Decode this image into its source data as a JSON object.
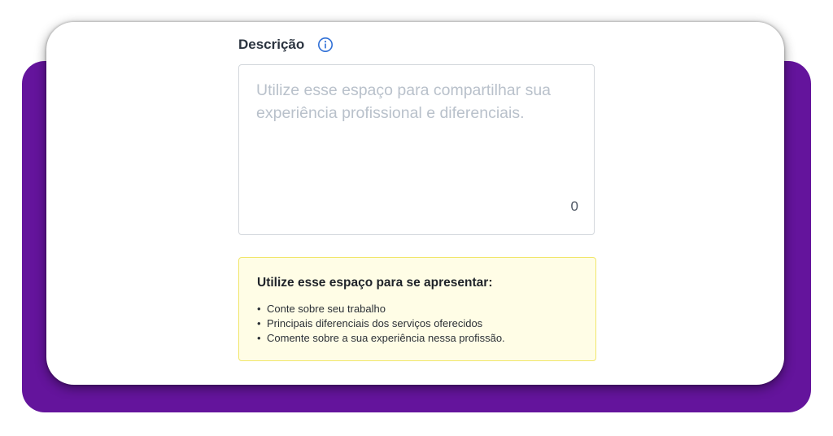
{
  "colors": {
    "backdrop": "#64149c",
    "accent": "#2f6fd6",
    "tip_background": "#fffde6",
    "tip_border": "#f1e66b"
  },
  "description": {
    "label": "Descrição",
    "info_icon": "info-circle-icon",
    "value": "",
    "placeholder": "Utilize esse espaço para compartilhar sua experiência profissional e diferenciais.",
    "char_count": "0"
  },
  "tip": {
    "title": "Utilize esse espaço para se apresentar:",
    "items": [
      "Conte sobre seu trabalho",
      "Principais diferenciais dos serviços oferecidos",
      "Comente sobre a sua experiência nessa profissão."
    ]
  }
}
